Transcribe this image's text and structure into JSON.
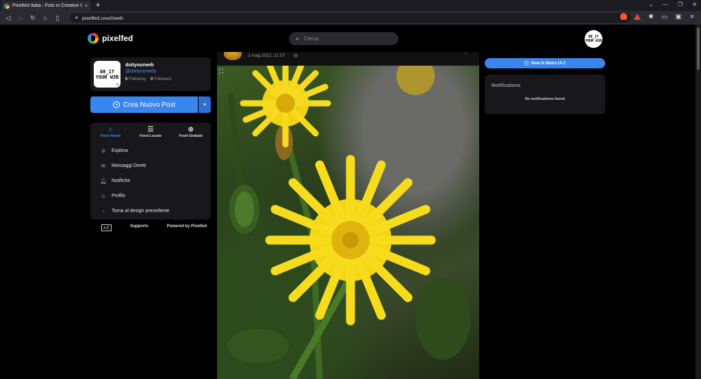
{
  "browser": {
    "tab_title": "Pixelfed Italia - Foto in Creative C",
    "tab_close": "×",
    "new_tab": "+",
    "url": "pixelfed.uno/i/web",
    "window_controls": [
      "⌄",
      "—",
      "❐",
      "✕"
    ]
  },
  "header": {
    "logo_text": "pixelfed",
    "search_placeholder": "Cerca",
    "avatar_text": "D0_1T YOUR W3B"
  },
  "profile": {
    "avatar_text": "D0_1T YOUR W3B",
    "name": "doityourweb",
    "handle": "@doityourweb",
    "following_count": "6",
    "following_label": "Following",
    "followers_count": "0",
    "followers_label": "Followers"
  },
  "create_post": {
    "label": "Crea Nuovo Post",
    "dropdown_icon": "▾"
  },
  "feeds": [
    {
      "label": "Feed Home",
      "icon": "⌂",
      "icon_name": "home-icon",
      "active": true
    },
    {
      "label": "Feed Locale",
      "icon": "☰",
      "icon_name": "server-icon",
      "active": false
    },
    {
      "label": "Feed Globale",
      "icon": "⊕",
      "icon_name": "globe-icon",
      "active": false
    }
  ],
  "menu": [
    {
      "label": "Esplora",
      "icon": "⊘",
      "icon_name": "compass-icon"
    },
    {
      "label": "Messaggi Diretti",
      "icon": "✉",
      "icon_name": "envelope-icon"
    },
    {
      "label": "Notifiche",
      "icon": "🔔︎",
      "icon_name": "bell-icon"
    },
    {
      "label": "Profilo",
      "icon": "☺",
      "icon_name": "user-icon"
    },
    {
      "label": "Torna al design precedente",
      "icon": "‹",
      "icon_name": "chevron-left-icon"
    }
  ],
  "footer": {
    "lang_label": "A文",
    "support": "Supporto",
    "powered_by": "Powered by Pixelfed"
  },
  "post": {
    "timestamp": "2 mag 2022, 21:57",
    "separator": "·",
    "visibility_icon": "◍",
    "more_icon": "⋮",
    "expand_icon": "⛶"
  },
  "right": {
    "metro_label": "New in Metro UI 2",
    "notifications_title": "Notifications",
    "notifications_empty": "No notifications found"
  },
  "colors": {
    "accent": "#3a86ef",
    "card_bg": "#18181b",
    "page_bg": "#000000"
  }
}
